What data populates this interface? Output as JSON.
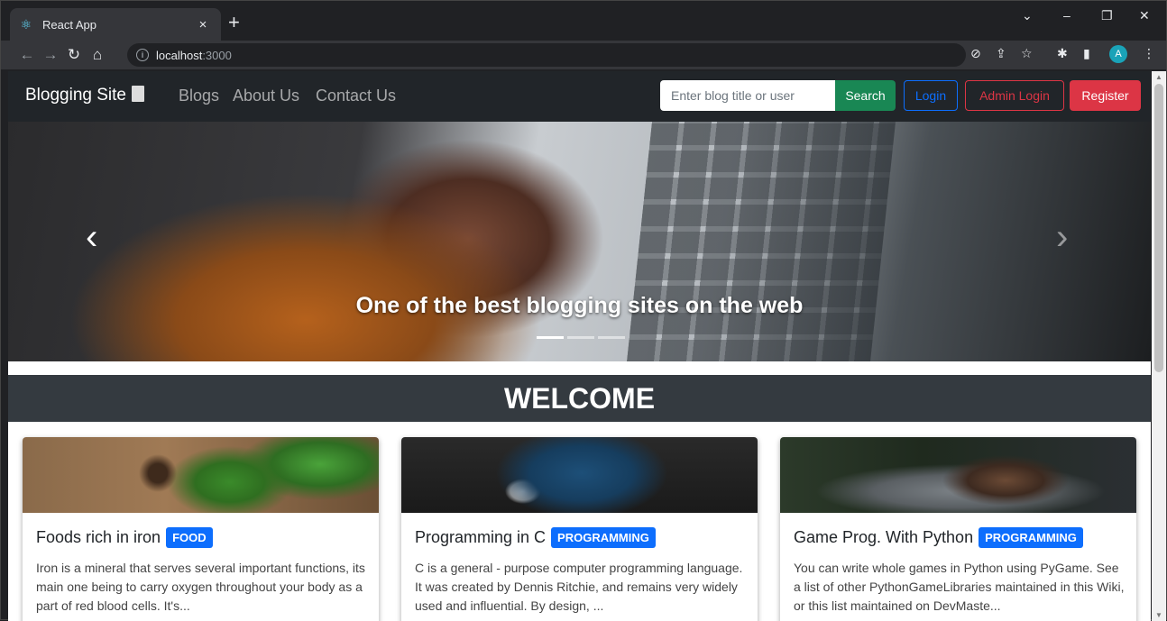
{
  "browser": {
    "tab_title": "React App",
    "tab_close": "×",
    "new_tab": "+",
    "url_host": "localhost",
    "url_port": ":3000",
    "window_controls": [
      "⌄",
      "–",
      "❐",
      "✕"
    ],
    "profile_initial": "A"
  },
  "navbar": {
    "brand": "Blogging Site",
    "links": [
      "Blogs",
      "About Us",
      "Contact Us"
    ],
    "search_placeholder": "Enter blog title or user",
    "search_button": "Search",
    "login_button": "Login",
    "admin_login_button": "Admin Login",
    "register_button": "Register"
  },
  "carousel": {
    "caption": "One of the best blogging sites on the web",
    "prev": "‹",
    "next": "›",
    "slide_count": 3,
    "active_slide": 0
  },
  "welcome": "WELCOME",
  "cards": [
    {
      "title": "Foods rich in iron",
      "badge": "FOOD",
      "text": "Iron is a mineral that serves several important functions, its main one being to carry oxygen throughout your body as a part of red blood cells. It's..."
    },
    {
      "title": "Programming in C",
      "badge": "PROGRAMMING",
      "text": "C is a general - purpose computer programming language. It was created by Dennis Ritchie, and remains very widely used and influential. By design, ..."
    },
    {
      "title": "Game Prog. With Python",
      "badge": "PROGRAMMING",
      "text": "You can write whole games in Python using PyGame. See a list of other PythonGameLibraries maintained in this Wiki, or this list maintained on DevMaste..."
    }
  ],
  "colors": {
    "navbar_bg": "#212529",
    "success": "#198754",
    "primary": "#0d6efd",
    "danger": "#dc3545",
    "welcome_bg": "#343a40"
  }
}
